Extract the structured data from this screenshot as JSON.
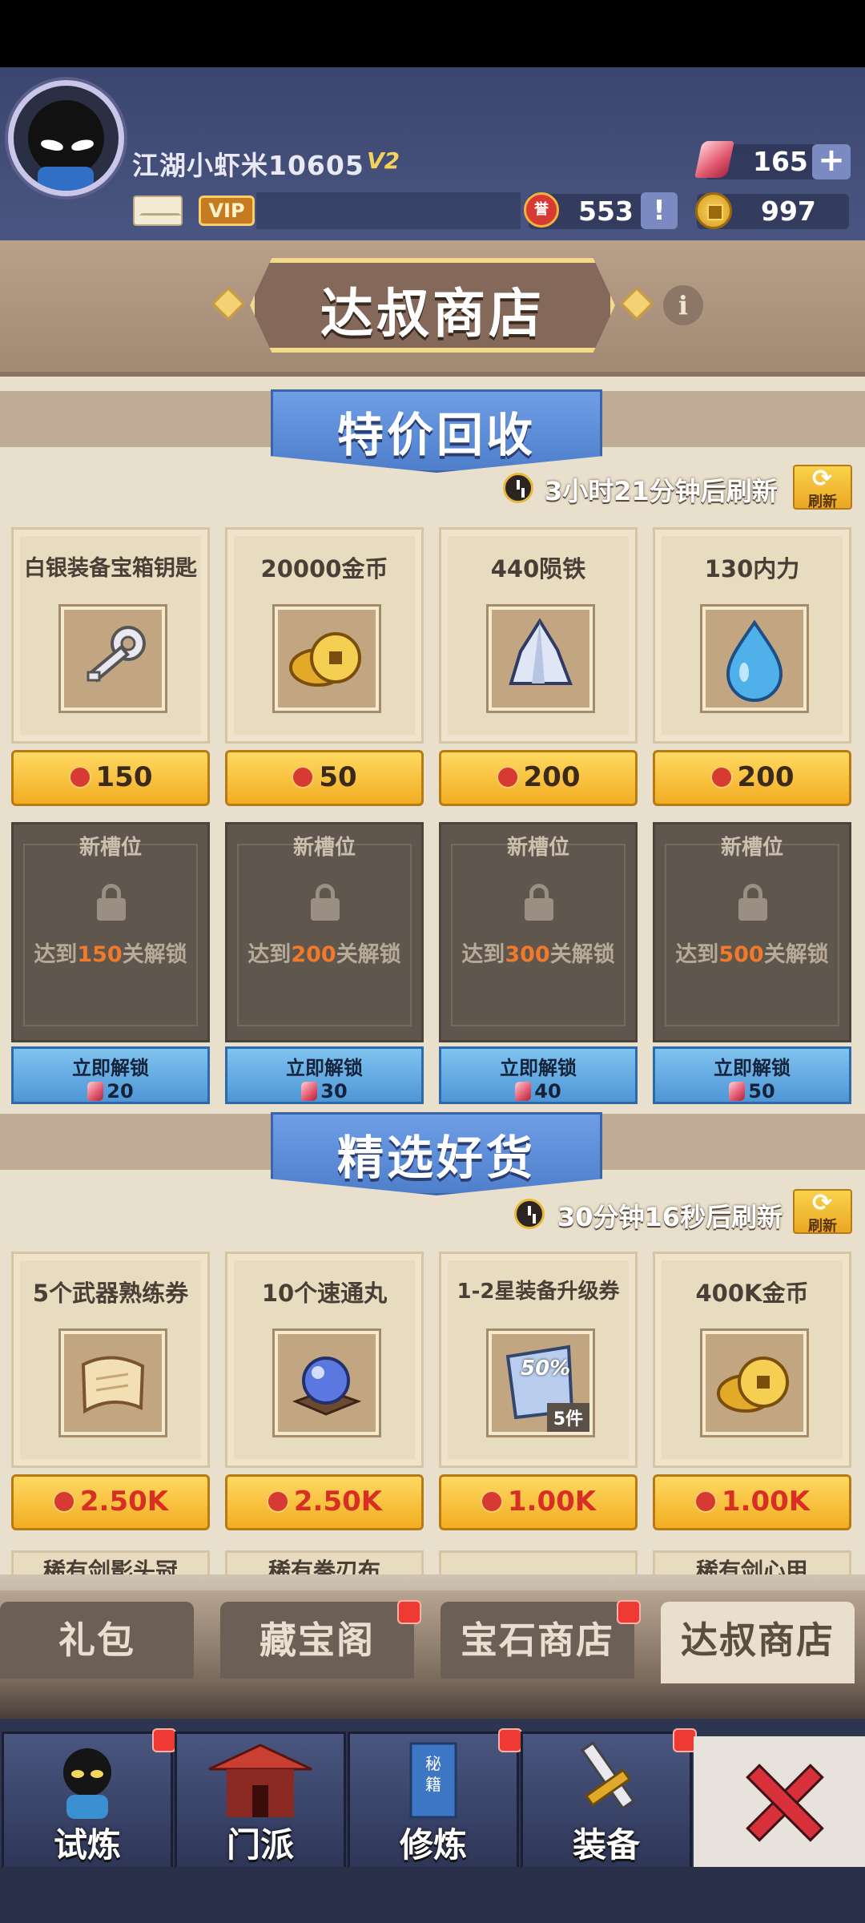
{
  "player": {
    "name": "江湖小虾米10605",
    "level": "V2",
    "vip_label": "VIP"
  },
  "resources": {
    "gems": "165",
    "tokens": "553",
    "coins": "997"
  },
  "shop": {
    "title": "达叔商店"
  },
  "special": {
    "title": "特价回收",
    "timer": "3小时21分钟后刷新",
    "refresh_label": "刷新",
    "items": [
      {
        "name": "白银装备宝箱钥匙",
        "price": "150",
        "icon": "key-icon"
      },
      {
        "name": "20000金币",
        "price": "50",
        "icon": "gold-coins-icon"
      },
      {
        "name": "440陨铁",
        "price": "200",
        "icon": "meteor-iron-icon"
      },
      {
        "name": "130内力",
        "price": "200",
        "icon": "water-drop-icon"
      }
    ],
    "locked_slots": [
      {
        "label": "新槽位",
        "pre": "达到",
        "level": "150",
        "post": "关解锁",
        "unlock_label": "立即解锁",
        "cost": "20"
      },
      {
        "label": "新槽位",
        "pre": "达到",
        "level": "200",
        "post": "关解锁",
        "unlock_label": "立即解锁",
        "cost": "30"
      },
      {
        "label": "新槽位",
        "pre": "达到",
        "level": "300",
        "post": "关解锁",
        "unlock_label": "立即解锁",
        "cost": "40"
      },
      {
        "label": "新槽位",
        "pre": "达到",
        "level": "500",
        "post": "关解锁",
        "unlock_label": "立即解锁",
        "cost": "50"
      }
    ]
  },
  "featured": {
    "title": "精选好货",
    "timer": "30分钟16秒后刷新",
    "refresh_label": "刷新",
    "items": [
      {
        "name": "5个武器熟练券",
        "price": "2.50K",
        "icon": "scroll-icon"
      },
      {
        "name": "10个速通丸",
        "price": "2.50K",
        "icon": "crystal-ball-icon"
      },
      {
        "name": "1-2星装备升级券",
        "price": "1.00K",
        "icon": "upgrade-ticket-icon",
        "badge": "50%",
        "count": "5件"
      },
      {
        "name": "400K金币",
        "price": "1.00K",
        "icon": "gold-coins-icon"
      }
    ],
    "peek_items": [
      "稀有剑影头冠",
      "稀有拳刃布",
      "",
      "稀有剑心甲"
    ]
  },
  "tabs": [
    "礼包",
    "藏宝阁",
    "宝石商店",
    "达叔商店"
  ],
  "nav": [
    "试炼",
    "门派",
    "修炼",
    "装备"
  ],
  "colors": {
    "accent_gold": "#f2ad22",
    "price_red": "#d82f25",
    "unlock_blue": "#4f96d6",
    "header_bg": "#3b466f"
  }
}
